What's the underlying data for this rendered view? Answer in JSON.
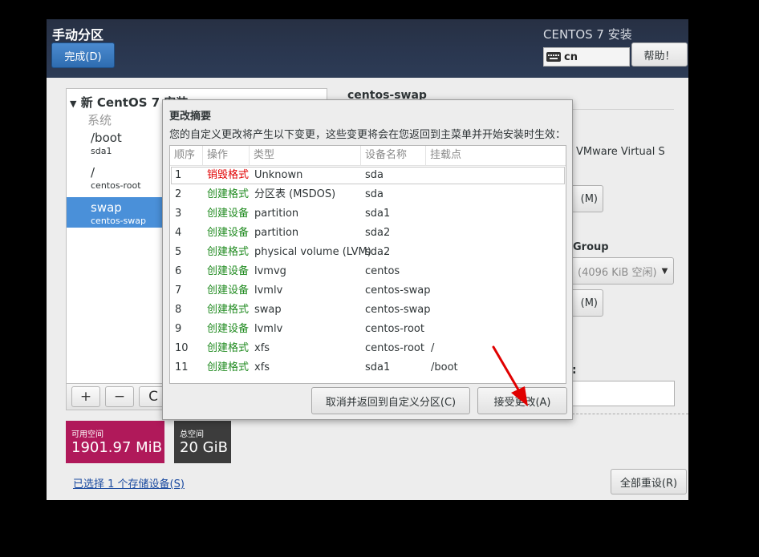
{
  "header": {
    "title": "手动分区",
    "done_label": "完成(D)",
    "installer_title": "CENTOS 7 安装",
    "keyboard_layout": "cn",
    "help_label": "帮助！"
  },
  "left_panel": {
    "install_header": "新 CentOS 7 安装",
    "system_label": "系统",
    "mount_points": [
      {
        "name": "/boot",
        "device": "sda1"
      },
      {
        "name": "/",
        "device": "centos-root"
      },
      {
        "name": "swap",
        "device": "centos-swap"
      }
    ],
    "tools": {
      "add": "+",
      "remove": "−",
      "refresh": "C"
    }
  },
  "space": {
    "available_label": "可用空间",
    "available_value": "1901.97 MiB",
    "total_label": "总空间",
    "total_value": "20 GiB"
  },
  "storage_link": "已选择 1 个存储设备(S)",
  "reset_label": "全部重设(R)",
  "right_panel": {
    "title": "centos-swap",
    "device_text": "VMware Virtual S",
    "modify_btn_1": "(M)",
    "group_label": "Group",
    "vg_select": "(4096 KiB 空闲)",
    "modify_btn_2": "(M)",
    "label_colon": ":"
  },
  "dialog": {
    "title": "更改摘要",
    "description": "您的自定义更改将产生以下变更，这些变更将会在您返回到主菜单并开始安装时生效：",
    "columns": [
      "顺序",
      "操作",
      "类型",
      "设备名称",
      "挂载点"
    ],
    "rows": [
      {
        "order": "1",
        "action": "销毁格式",
        "type": "Unknown",
        "device": "sda",
        "mount": ""
      },
      {
        "order": "2",
        "action": "创建格式",
        "type": "分区表 (MSDOS)",
        "device": "sda",
        "mount": ""
      },
      {
        "order": "3",
        "action": "创建设备",
        "type": "partition",
        "device": "sda1",
        "mount": ""
      },
      {
        "order": "4",
        "action": "创建设备",
        "type": "partition",
        "device": "sda2",
        "mount": ""
      },
      {
        "order": "5",
        "action": "创建格式",
        "type": "physical volume (LVM)",
        "device": "sda2",
        "mount": ""
      },
      {
        "order": "6",
        "action": "创建设备",
        "type": "lvmvg",
        "device": "centos",
        "mount": ""
      },
      {
        "order": "7",
        "action": "创建设备",
        "type": "lvmlv",
        "device": "centos-swap",
        "mount": ""
      },
      {
        "order": "8",
        "action": "创建格式",
        "type": "swap",
        "device": "centos-swap",
        "mount": ""
      },
      {
        "order": "9",
        "action": "创建设备",
        "type": "lvmlv",
        "device": "centos-root",
        "mount": ""
      },
      {
        "order": "10",
        "action": "创建格式",
        "type": "xfs",
        "device": "centos-root",
        "mount": "/"
      },
      {
        "order": "11",
        "action": "创建格式",
        "type": "xfs",
        "device": "sda1",
        "mount": "/boot"
      }
    ],
    "cancel_label": "取消并返回到自定义分区(C)",
    "accept_label": "接受更改(A)"
  },
  "colors": {
    "destroy": "#e00000",
    "create": "#1f8a1f",
    "selection": "#4a90d9",
    "available_space": "#b0195a",
    "annotation_arrow": "#e00000"
  }
}
